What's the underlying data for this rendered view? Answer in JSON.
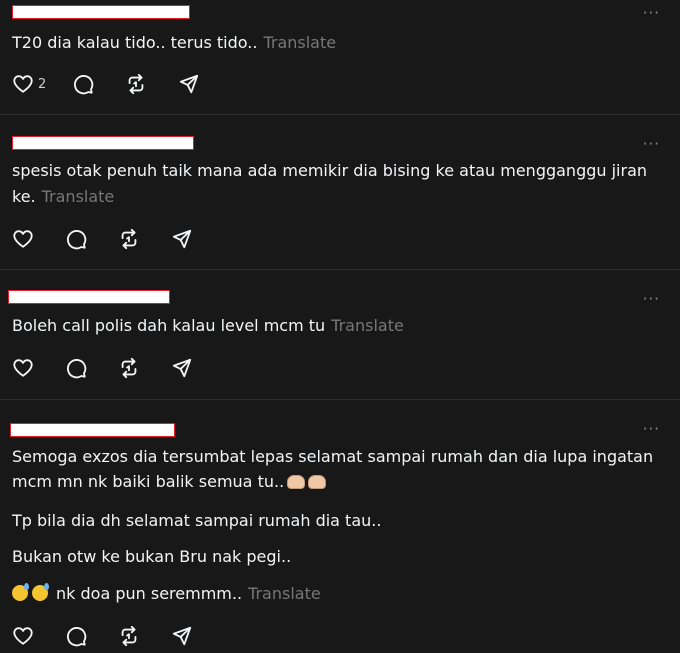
{
  "posts": [
    {
      "lines": [
        "T20 dia kalau tido.. terus tido.."
      ],
      "translate_label": "Translate",
      "like_count": "2"
    },
    {
      "lines": [
        "spesis otak penuh taik mana ada memikir dia bising ke atau mengganggu jiran",
        "ke."
      ],
      "translate_label": "Translate",
      "like_count": ""
    },
    {
      "lines": [
        "Boleh call polis dah kalau level mcm tu"
      ],
      "translate_label": "Translate",
      "like_count": ""
    },
    {
      "lines": [
        "Semoga exzos dia tersumbat lepas selamat sampai rumah dan dia lupa ingatan",
        "mcm mn nk baiki balik semua tu..",
        "Tp bila dia dh selamat sampai rumah dia tau..",
        "Bukan otw ke bukan Bru nak pegi..",
        "nk doa pun seremmm.."
      ],
      "translate_label": "Translate",
      "like_count": ""
    }
  ],
  "more_label": "···",
  "icons": [
    "heart-icon",
    "comment-icon",
    "repost-icon",
    "share-icon",
    "more-icon"
  ],
  "colors": {
    "background": "#181818",
    "text": "#f3f5f7",
    "translate": "#777777",
    "divider": "#2d2d2d",
    "redaction_border": "#e0202a"
  }
}
